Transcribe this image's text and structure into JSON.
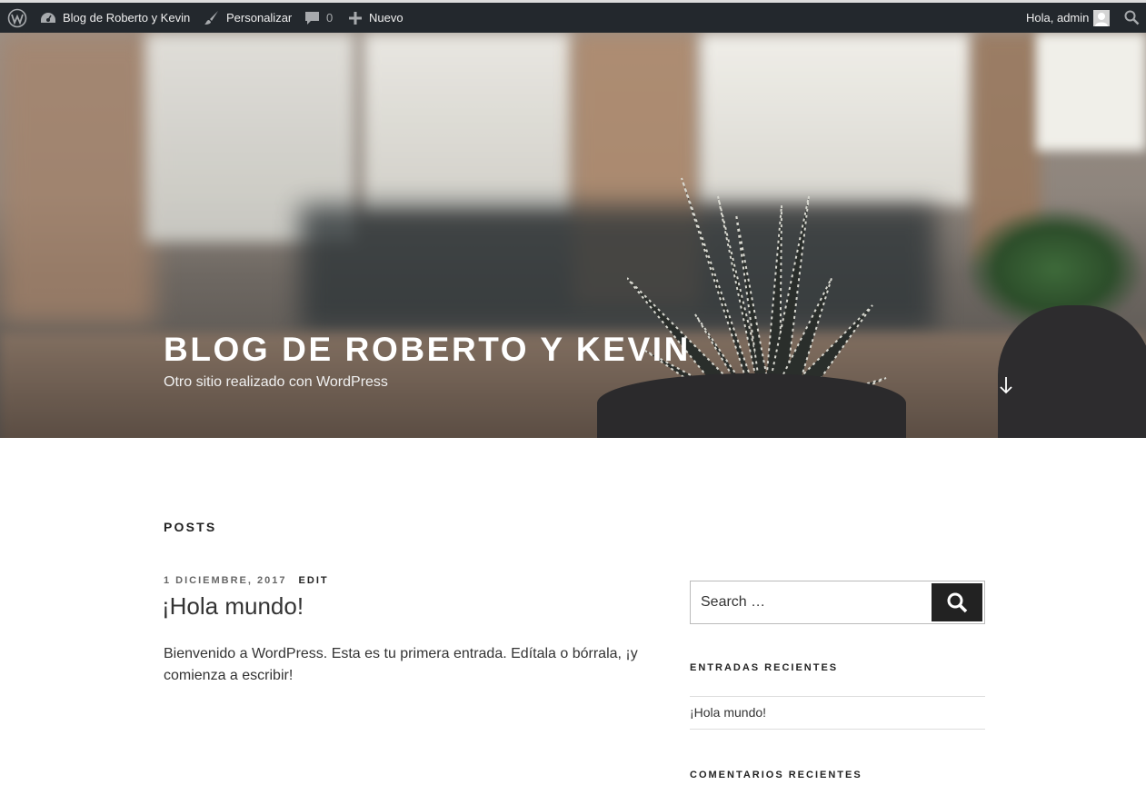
{
  "admin_bar": {
    "site_name": "Blog de Roberto y Kevin",
    "customize": "Personalizar",
    "comments_count": "0",
    "new": "Nuevo",
    "greeting": "Hola, admin"
  },
  "header": {
    "title": "BLOG DE ROBERTO Y KEVIN",
    "tagline": "Otro sitio realizado con WordPress"
  },
  "main": {
    "section_heading": "POSTS",
    "post": {
      "date": "1 DICIEMBRE, 2017",
      "edit": "EDIT",
      "title": "¡Hola mundo!",
      "content": "Bienvenido a WordPress. Esta es tu primera entrada. Edítala o bórrala, ¡y comienza a escribir!"
    }
  },
  "sidebar": {
    "search_placeholder": "Search …",
    "recent_posts_title": "ENTRADAS RECIENTES",
    "recent_posts": [
      "¡Hola mundo!"
    ],
    "recent_comments_title": "COMENTARIOS RECIENTES"
  },
  "colors": {
    "admin_bar_bg": "#23282d",
    "search_button_bg": "#222222"
  }
}
